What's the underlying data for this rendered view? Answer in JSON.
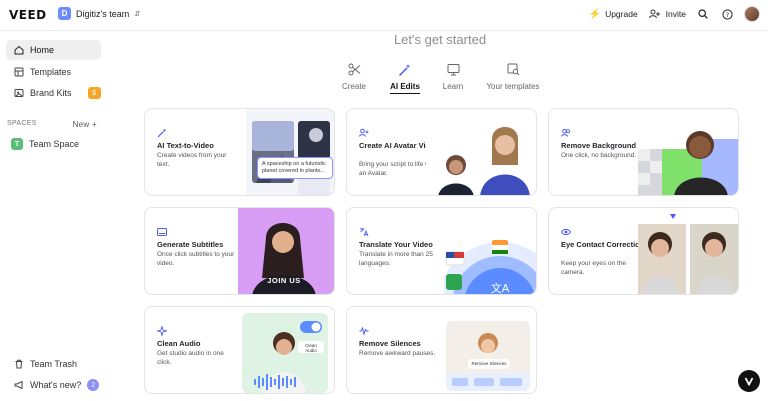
{
  "app": {
    "logo": "VEED"
  },
  "team": {
    "badge": "D",
    "name": "Digitiz's team"
  },
  "topbar": {
    "upgrade": "Upgrade",
    "invite": "Invite"
  },
  "sidebar": {
    "items": [
      {
        "label": "Home"
      },
      {
        "label": "Templates"
      },
      {
        "label": "Brand Kits",
        "badge": "$"
      }
    ],
    "spaces_label": "SPACES",
    "new_label": "New +",
    "team_space": {
      "badge": "T",
      "label": "Team Space"
    },
    "team_trash": "Team Trash",
    "whats_new": "What's new?",
    "whats_new_count": "2"
  },
  "main": {
    "title": "Let's get started",
    "tabs": [
      {
        "label": "Create"
      },
      {
        "label": "AI Edits"
      },
      {
        "label": "Learn"
      },
      {
        "label": "Your templates"
      }
    ],
    "cards": [
      {
        "title": "AI Text-to-Video",
        "desc": "Create videos from your text.",
        "bubble": "A spaceship on a futuristic planet covered in plants..."
      },
      {
        "title": "Create AI Avatar Video",
        "desc": "Bring your script to life with an Avatar."
      },
      {
        "title": "Remove Background",
        "desc": "One click, no background."
      },
      {
        "title": "Generate Subtitles",
        "desc": "Once click subtitles to your video.",
        "caption": "JOIN US"
      },
      {
        "title": "Translate Your Video",
        "desc": "Translate in more than 25 languages."
      },
      {
        "title": "Eye Contact Correction",
        "desc": "Keep your eyes on the camera."
      },
      {
        "title": "Clean Audio",
        "desc": "Get studio audio in one click.",
        "toggle_label": "Clean Audio"
      },
      {
        "title": "Remove Silences",
        "desc": "Remove awkward pauses.",
        "pill": "Remove Silences"
      }
    ]
  }
}
